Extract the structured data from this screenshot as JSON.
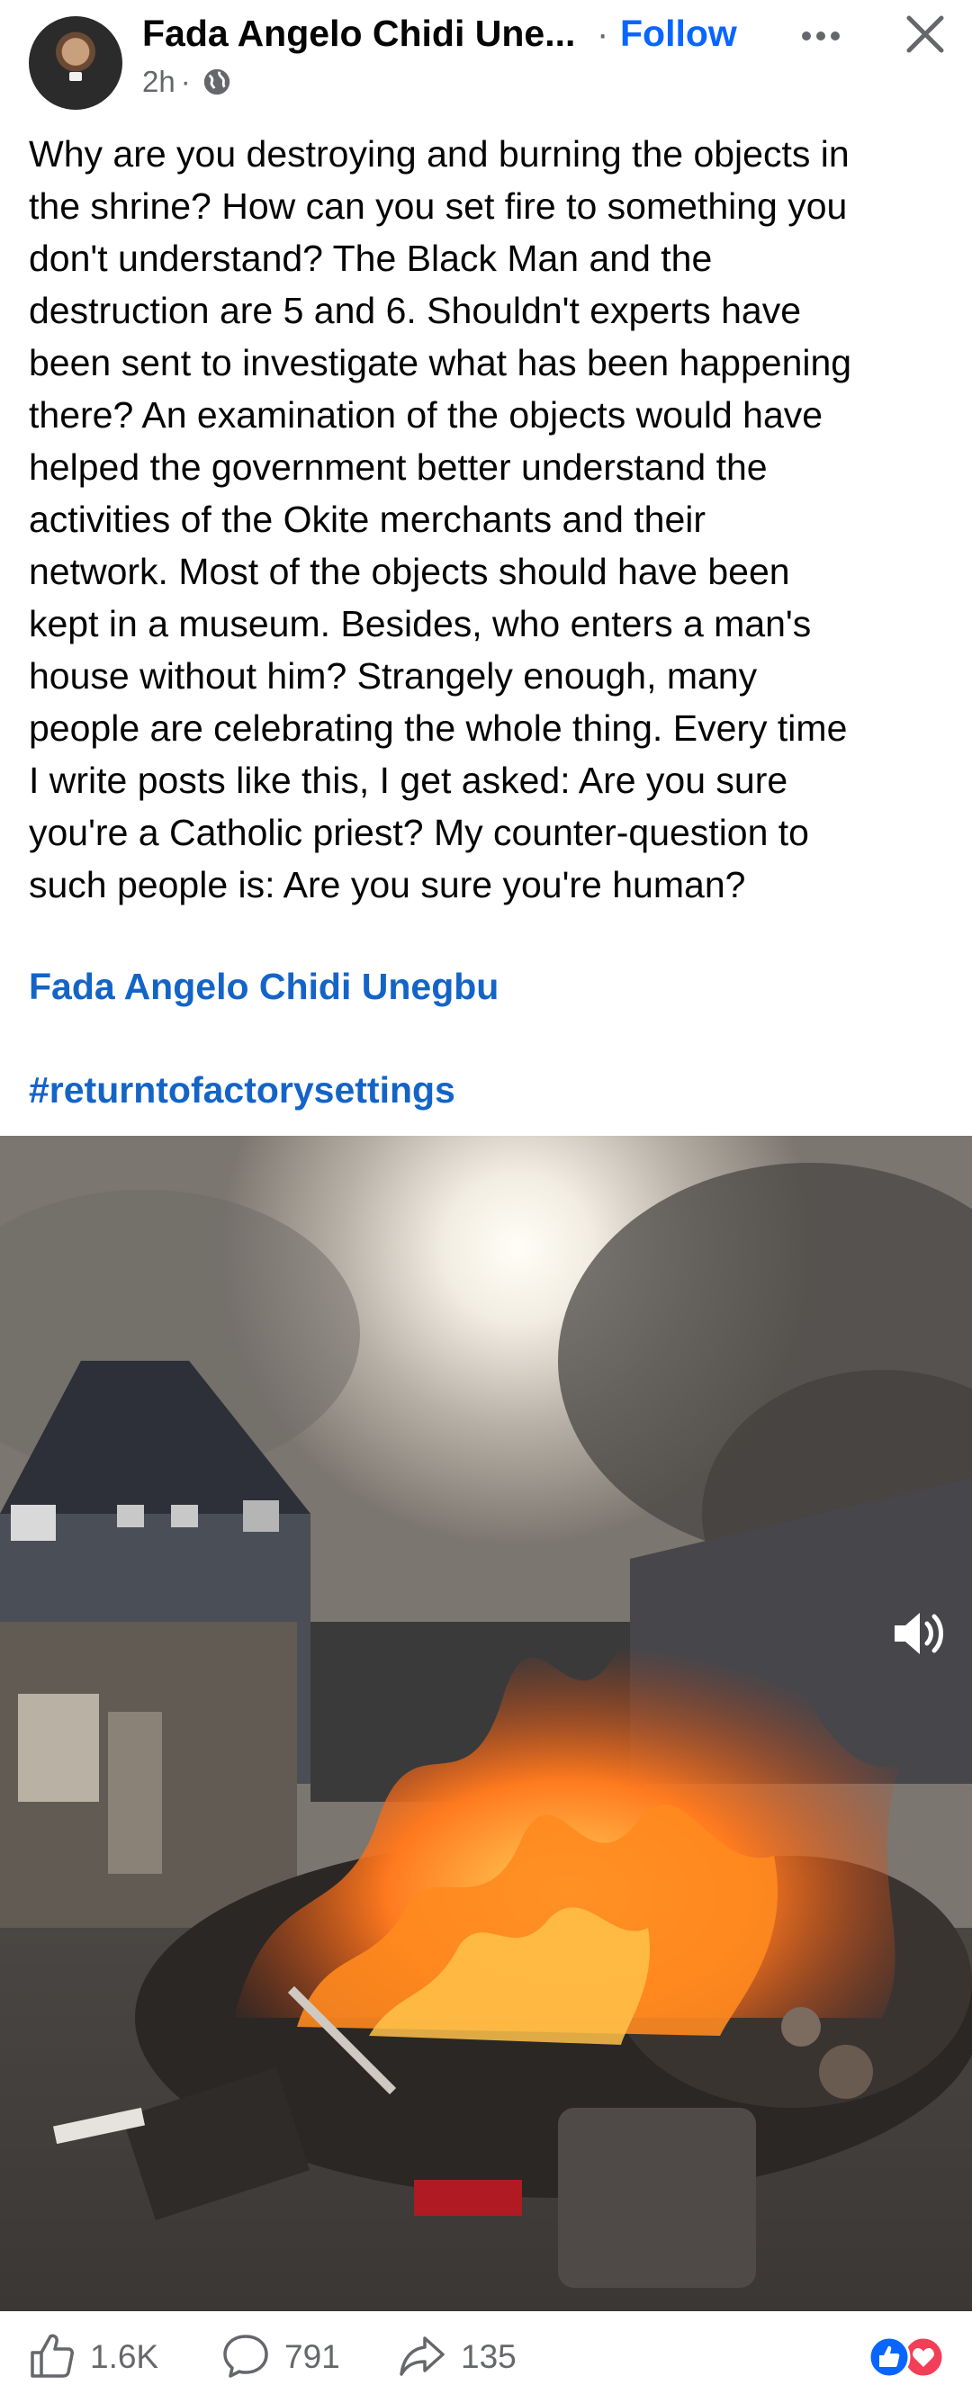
{
  "header": {
    "author_name": "Fada Angelo Chidi Une...",
    "separator": "·",
    "follow_label": "Follow",
    "time": "2h",
    "meta_separator": "·",
    "privacy_icon": "globe-icon",
    "more_icon": "more-horizontal-icon",
    "close_icon": "close-icon"
  },
  "post": {
    "text": "Why are you destroying and burning the objects in\nthe shrine? How can you set fire to something you\ndon't understand? The Black Man and the\ndestruction are  5 and 6. Shouldn't experts have\nbeen sent to investigate what has been happening\nthere? An examination of the objects would have\nhelped the government better understand the\nactivities of the Okite merchants and their\nnetwork. Most of the objects should have been\nkept in a museum. Besides, who enters a man's\nhouse without him? Strangely enough, many\npeople are celebrating the whole thing. Every time\nI write posts like this, I get asked: Are you sure\nyou're a Catholic priest? My counter-question to\nsuch people is: Are you sure you're human?",
    "author_link": "Fada Angelo Chidi Unegbu",
    "hashtag": "#returntofactorysettings"
  },
  "media": {
    "description_icon": "video-thumbnail",
    "volume_icon": "volume-icon"
  },
  "footer": {
    "likes": "1.6K",
    "comments": "791",
    "shares": "135",
    "like_icon": "thumbs-up-icon",
    "comment_icon": "comment-icon",
    "share_icon": "share-icon",
    "reaction_icons": [
      "like-reaction-icon",
      "love-reaction-icon"
    ]
  },
  "colors": {
    "link_blue": "#1464c8",
    "follow_blue": "#0866ff",
    "secondary_text": "#65676b",
    "like_blue": "#0866ff",
    "love_red": "#f33e58"
  }
}
